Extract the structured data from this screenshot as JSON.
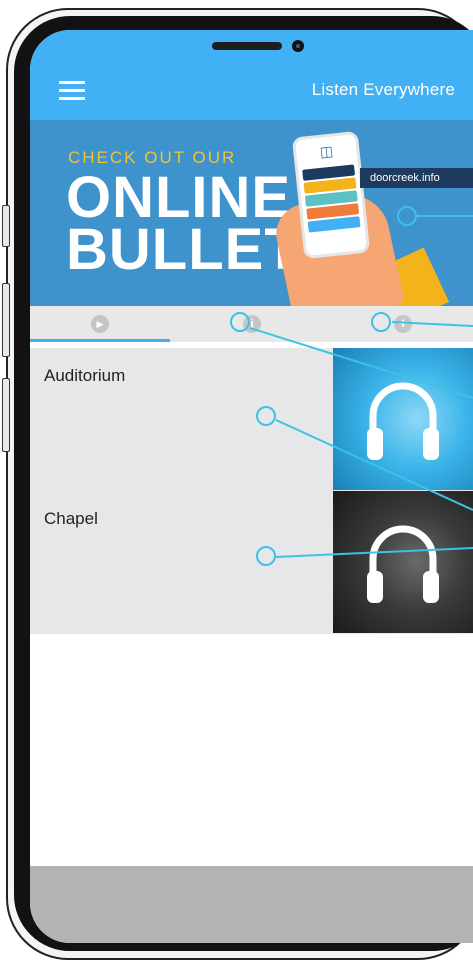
{
  "header": {
    "title": "Listen Everywhere",
    "menu_icon": "hamburger-menu-icon"
  },
  "banner": {
    "line_small": "CHECK OUT OUR",
    "line_big_1": "ONLINE",
    "line_big_2": "BULLETIN",
    "url": "doorcreek.info"
  },
  "tabs": [
    {
      "icon": "play-icon",
      "glyph": "▶",
      "active": true
    },
    {
      "icon": "info-icon",
      "glyph": "i",
      "active": false
    },
    {
      "icon": "plus-icon",
      "glyph": "+",
      "active": false
    }
  ],
  "channels": [
    {
      "label": "Auditorium",
      "thumb": "headphones-blue"
    },
    {
      "label": "Chapel",
      "thumb": "headphones-dark"
    }
  ],
  "colors": {
    "header": "#42b0f4",
    "banner": "#3f93cc",
    "callout": "#3ec1e6",
    "bottom_bar": "#b3b3b3"
  }
}
